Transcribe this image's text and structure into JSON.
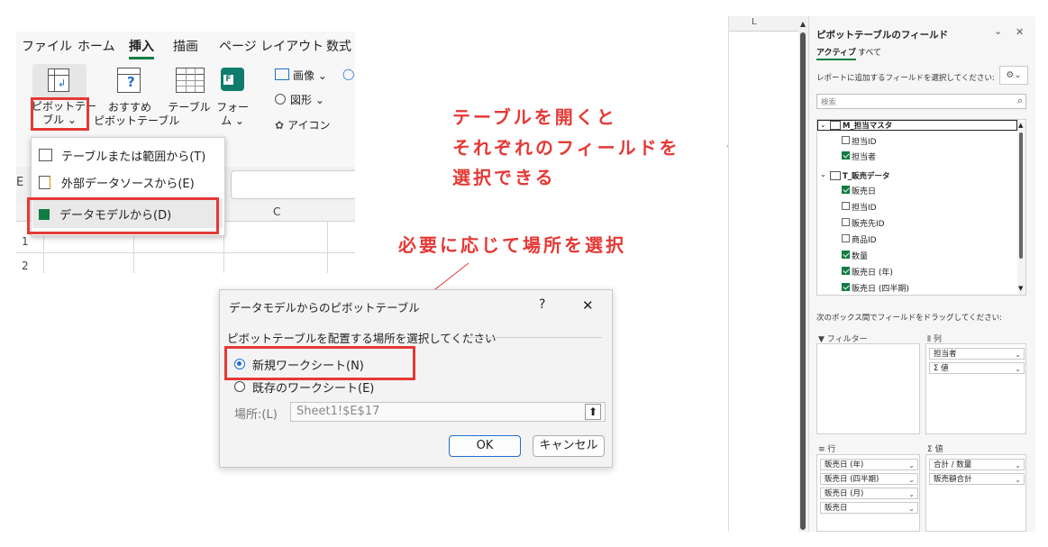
{
  "ribbon": {
    "tabs": [
      "ファイル",
      "ホーム",
      "挿入",
      "描画",
      "ページ レイアウト",
      "数式"
    ],
    "buttons": {
      "pivot": [
        "ピボットテー",
        "ブル ⌄"
      ],
      "recommended": [
        "おすすめ",
        "ピボットテーブル"
      ],
      "table": "テーブル",
      "forms": [
        "フォー",
        "ム ⌄"
      ],
      "image": "画像 ⌄",
      "shapes": "図形 ⌄",
      "icons": "アイコン"
    }
  },
  "menu": {
    "items": [
      "テーブルまたは範囲から(T)",
      "外部データソースから(E)",
      "データモデルから(D)"
    ]
  },
  "grid": {
    "col_letter": "E",
    "col_c": "C",
    "rows": [
      "1",
      "2"
    ]
  },
  "dialog": {
    "title": "データモデルからのピボットテーブル",
    "help": "?",
    "close": "✕",
    "prompt": "ピボットテーブルを配置する場所を選択してください",
    "opt_new": "新規ワークシート(N)",
    "opt_existing": "既存のワークシート(E)",
    "location_label": "場所:(L)",
    "location_value": "Sheet1!$E$17",
    "ok": "OK",
    "cancel": "キャンセル"
  },
  "annotations": {
    "note1_line1": "テーブルを開くと",
    "note1_line2": "それぞれのフィールドを",
    "note1_line3": "選択できる",
    "note2": "必要に応じて場所を選択"
  },
  "sheet": {
    "col": "L"
  },
  "pane": {
    "title": "ピボットテーブルのフィールド",
    "tab_active": "アクティブ",
    "tab_all": "すべて",
    "instruction": "レポートに追加するフィールドを選択してください:",
    "search_placeholder": "検索",
    "table1": {
      "name": "M_担当マスタ",
      "fields": [
        {
          "label": "担当ID",
          "checked": false
        },
        {
          "label": "担当者",
          "checked": true
        }
      ]
    },
    "table2": {
      "name": "T_販売データ",
      "fields": [
        {
          "label": "販売日",
          "checked": true
        },
        {
          "label": "担当ID",
          "checked": false
        },
        {
          "label": "販売先ID",
          "checked": false
        },
        {
          "label": "商品ID",
          "checked": false
        },
        {
          "label": "数量",
          "checked": true
        },
        {
          "label": "販売日 (年)",
          "checked": true
        },
        {
          "label": "販売日 (四半期)",
          "checked": true
        }
      ]
    },
    "drag_hint": "次のボックス間でフィールドをドラッグしてください:",
    "filters_title": "フィルター",
    "columns_title": "列",
    "columns_items": [
      "担当者",
      "Σ 値"
    ],
    "rows_title": "行",
    "rows_items": [
      "販売日 (年)",
      "販売日 (四半期)",
      "販売日 (月)",
      "販売日"
    ],
    "values_title": "Σ 値",
    "values_items": [
      "合計 / 数量",
      "販売額合計"
    ]
  },
  "colors": {
    "accent_red": "#e53935",
    "excel_green": "#107c41"
  }
}
